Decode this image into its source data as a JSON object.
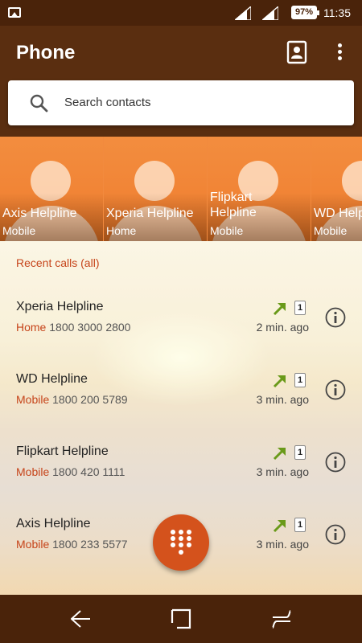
{
  "status_bar": {
    "battery": "97%",
    "time": "11:35",
    "icons": [
      "gallery-icon",
      "signal-icon",
      "signal-icon",
      "battery-icon"
    ]
  },
  "header": {
    "title": "Phone",
    "icons": [
      "contacts-icon",
      "more-vert-icon"
    ]
  },
  "search": {
    "placeholder": "Search contacts",
    "icon": "search-icon"
  },
  "favorites": [
    {
      "name": "Axis Helpline",
      "type": "Mobile"
    },
    {
      "name": "Xperia Helpline",
      "type": "Home"
    },
    {
      "name": "Flipkart Helpline",
      "type": "Mobile"
    },
    {
      "name": "WD Helpline",
      "type": "Mobile"
    }
  ],
  "recents": {
    "title": "Recent calls (all)",
    "calls": [
      {
        "name": "Xperia Helpline",
        "type": "Home",
        "number": "1800 3000 2800",
        "time": "2 min. ago",
        "sim": "1",
        "direction": "outgoing"
      },
      {
        "name": "WD Helpline",
        "type": "Mobile",
        "number": "1800 200 5789",
        "time": "3 min. ago",
        "sim": "1",
        "direction": "outgoing"
      },
      {
        "name": "Flipkart Helpline",
        "type": "Mobile",
        "number": "1800 420 1111",
        "time": "3 min. ago",
        "sim": "1",
        "direction": "outgoing"
      },
      {
        "name": "Axis Helpline",
        "type": "Mobile",
        "number": "1800 233 5577",
        "time": "3 min. ago",
        "sim": "1",
        "direction": "outgoing"
      }
    ]
  },
  "fab": {
    "icon": "dialpad-icon"
  },
  "nav": {
    "icons": [
      "back-icon",
      "home-icon",
      "recents-icon"
    ]
  },
  "colors": {
    "accent": "#c6441a",
    "header_bg": "#5a2e10",
    "favorite_tile": "#f28a3e",
    "outgoing_arrow": "#6a9a1a"
  }
}
